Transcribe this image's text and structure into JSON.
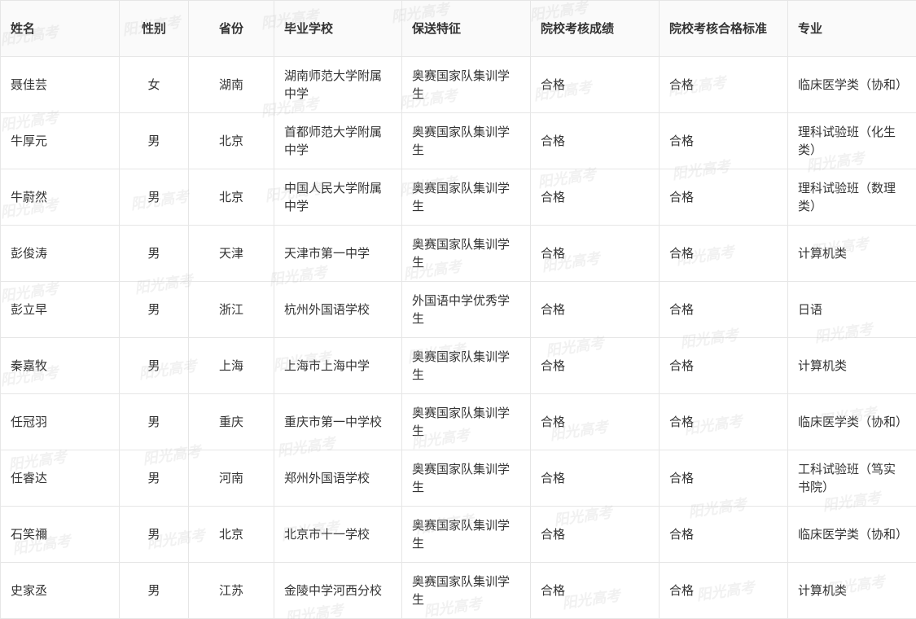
{
  "headers": {
    "name": "姓名",
    "gender": "性别",
    "province": "省份",
    "school": "毕业学校",
    "feature": "保送特征",
    "score": "院校考核成绩",
    "standard": "院校考核合格标准",
    "major": "专业"
  },
  "watermark": "阳光高考",
  "rows": [
    {
      "name": "聂佳芸",
      "gender": "女",
      "province": "湖南",
      "school": "湖南师范大学附属中学",
      "feature": "奥赛国家队集训学生",
      "score": "合格",
      "standard": "合格",
      "major": "临床医学类（协和）"
    },
    {
      "name": "牛厚元",
      "gender": "男",
      "province": "北京",
      "school": "首都师范大学附属中学",
      "feature": "奥赛国家队集训学生",
      "score": "合格",
      "standard": "合格",
      "major": "理科试验班（化生类）"
    },
    {
      "name": "牛蔚然",
      "gender": "男",
      "province": "北京",
      "school": "中国人民大学附属中学",
      "feature": "奥赛国家队集训学生",
      "score": "合格",
      "standard": "合格",
      "major": "理科试验班（数理类）"
    },
    {
      "name": "彭俊涛",
      "gender": "男",
      "province": "天津",
      "school": "天津市第一中学",
      "feature": "奥赛国家队集训学生",
      "score": "合格",
      "standard": "合格",
      "major": "计算机类"
    },
    {
      "name": "彭立早",
      "gender": "男",
      "province": "浙江",
      "school": "杭州外国语学校",
      "feature": "外国语中学优秀学生",
      "score": "合格",
      "standard": "合格",
      "major": "日语"
    },
    {
      "name": "秦嘉牧",
      "gender": "男",
      "province": "上海",
      "school": "上海市上海中学",
      "feature": "奥赛国家队集训学生",
      "score": "合格",
      "standard": "合格",
      "major": "计算机类"
    },
    {
      "name": "任冠羽",
      "gender": "男",
      "province": "重庆",
      "school": "重庆市第一中学校",
      "feature": "奥赛国家队集训学生",
      "score": "合格",
      "standard": "合格",
      "major": "临床医学类（协和）"
    },
    {
      "name": "任睿达",
      "gender": "男",
      "province": "河南",
      "school": "郑州外国语学校",
      "feature": "奥赛国家队集训学生",
      "score": "合格",
      "standard": "合格",
      "major": "工科试验班（笃实书院）"
    },
    {
      "name": "石笑禰",
      "gender": "男",
      "province": "北京",
      "school": "北京市十一学校",
      "feature": "奥赛国家队集训学生",
      "score": "合格",
      "standard": "合格",
      "major": "临床医学类（协和）"
    },
    {
      "name": "史家丞",
      "gender": "男",
      "province": "江苏",
      "school": "金陵中学河西分校",
      "feature": "奥赛国家队集训学生",
      "score": "合格",
      "standard": "合格",
      "major": "计算机类"
    }
  ]
}
